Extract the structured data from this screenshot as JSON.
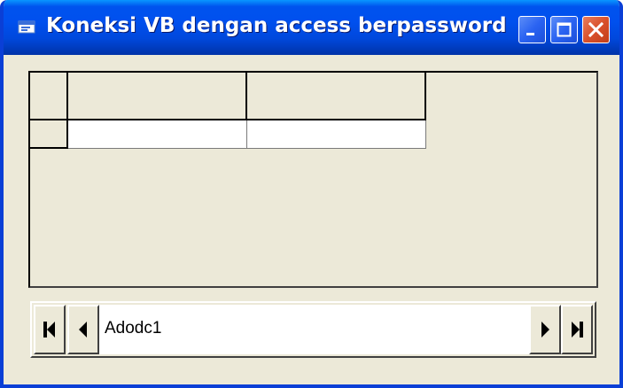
{
  "window": {
    "title": "Koneksi VB dengan access berpassword",
    "controls": {
      "minimize_icon": "minimize-icon",
      "maximize_icon": "maximize-icon",
      "close_icon": "close-icon"
    }
  },
  "datagrid": {
    "columns": [
      "",
      ""
    ],
    "rows": [
      [
        "",
        ""
      ]
    ]
  },
  "adodc": {
    "caption": "Adodc1",
    "buttons": {
      "first_icon": "move-first-icon",
      "prev_icon": "move-previous-icon",
      "next_icon": "move-next-icon",
      "last_icon": "move-last-icon"
    }
  },
  "colors": {
    "titlebar": "#0053ee",
    "window_face": "#ece9d8",
    "close_button": "#d9512b"
  }
}
